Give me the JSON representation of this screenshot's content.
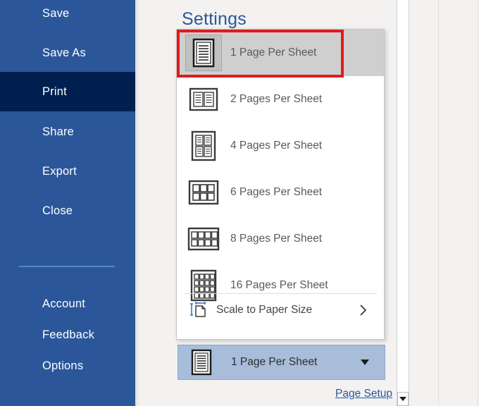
{
  "sidebar": {
    "items": [
      {
        "label": "Save",
        "active": false,
        "name": "sidebar-item-save"
      },
      {
        "label": "Save As",
        "active": false,
        "name": "sidebar-item-save-as"
      },
      {
        "label": "Print",
        "active": true,
        "name": "sidebar-item-print"
      },
      {
        "label": "Share",
        "active": false,
        "name": "sidebar-item-share"
      },
      {
        "label": "Export",
        "active": false,
        "name": "sidebar-item-export"
      },
      {
        "label": "Close",
        "active": false,
        "name": "sidebar-item-close"
      },
      {
        "label": "Account",
        "active": false,
        "name": "sidebar-item-account"
      },
      {
        "label": "Feedback",
        "active": false,
        "name": "sidebar-item-feedback"
      },
      {
        "label": "Options",
        "active": false,
        "name": "sidebar-item-options"
      }
    ],
    "bg_color": "#2b579a",
    "active_color": "#002050"
  },
  "main": {
    "title": "Settings"
  },
  "dropdown": {
    "items": [
      {
        "label": "1 Page Per Sheet",
        "icon": "pages-1-icon",
        "selected": true
      },
      {
        "label": "2 Pages Per Sheet",
        "icon": "pages-2-icon",
        "selected": false
      },
      {
        "label": "4 Pages Per Sheet",
        "icon": "pages-4-icon",
        "selected": false
      },
      {
        "label": "6 Pages Per Sheet",
        "icon": "pages-6-icon",
        "selected": false
      },
      {
        "label": "8 Pages Per Sheet",
        "icon": "pages-8-icon",
        "selected": false
      },
      {
        "label": "16 Pages Per Sheet",
        "icon": "pages-16-icon",
        "selected": false
      }
    ],
    "scale_item": {
      "label": "Scale to Paper Size",
      "icon": "scale-to-paper-size-icon",
      "submenu_icon": "chevron-right-icon"
    },
    "highlight_color": "#e01b1b",
    "selected_bg": "#cfcfcf"
  },
  "combo": {
    "value": "1 Page Per Sheet",
    "icon": "pages-1-icon",
    "arrow_icon": "chevron-down-icon",
    "bg_color": "#a8bdd9"
  },
  "links": {
    "page_setup": "Page Setup"
  },
  "scrollbar": {
    "down_arrow_icon": "scroll-down-arrow-icon"
  }
}
